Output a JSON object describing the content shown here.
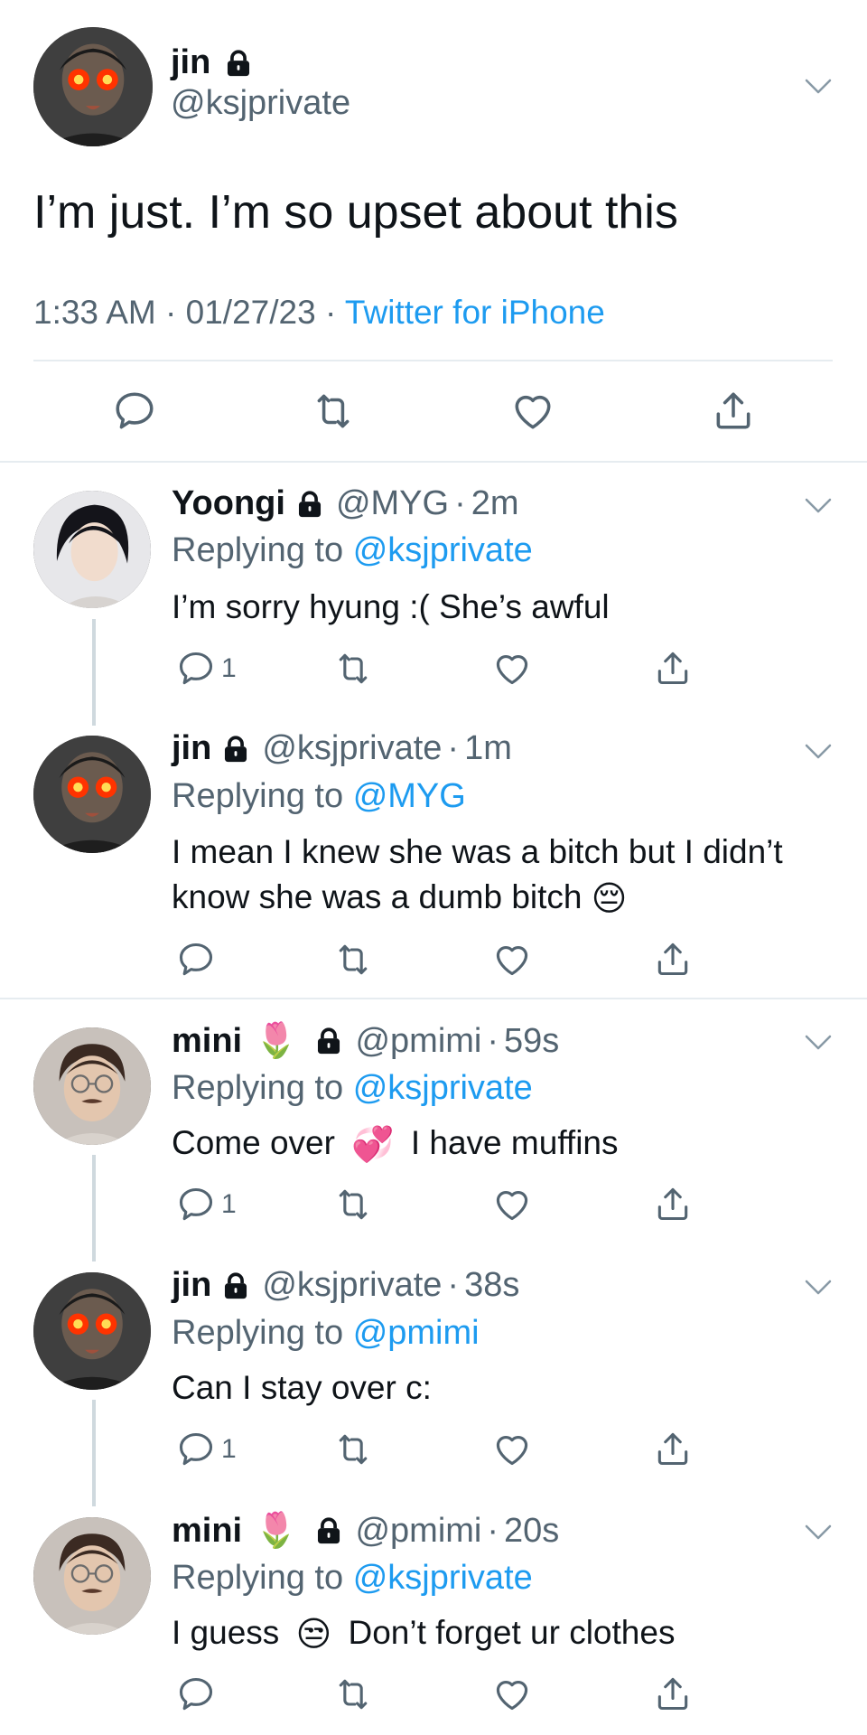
{
  "main_tweet": {
    "name": "jin",
    "handle": "@ksjprivate",
    "text": "I’m just. I’m so upset about this",
    "time": "1:33 AM",
    "date": "01/27/23",
    "source": "Twitter for iPhone",
    "sep": "·"
  },
  "replies": [
    {
      "name": "Yoongi",
      "handle": "@MYG",
      "time": "2m",
      "replying_label": "Replying to",
      "replying_to": "@ksjprivate",
      "text": "I’m sorry hyung :( She’s awful",
      "reply_count": "1"
    },
    {
      "name": "jin",
      "handle": "@ksjprivate",
      "time": "1m",
      "replying_label": "Replying to",
      "replying_to": "@MYG",
      "text_line1": "I mean I knew she was a bitch but I didn’t",
      "text_line2": "know she was a dumb bitch",
      "emoji": "😔"
    },
    {
      "name": "mini",
      "name_emoji": "🌷",
      "handle": "@pmimi",
      "time": "59s",
      "replying_label": "Replying to",
      "replying_to": "@ksjprivate",
      "text_a": "Come over",
      "emoji": "💞",
      "text_b": "I have muffins",
      "reply_count": "1"
    },
    {
      "name": "jin",
      "handle": "@ksjprivate",
      "time": "38s",
      "replying_label": "Replying to",
      "replying_to": "@pmimi",
      "text": "Can I stay over c:",
      "reply_count": "1"
    },
    {
      "name": "mini",
      "name_emoji": "🌷",
      "handle": "@pmimi",
      "time": "20s",
      "replying_label": "Replying to",
      "replying_to": "@ksjprivate",
      "text_a": "I guess",
      "emoji": "😒",
      "text_b": "Don’t forget ur clothes"
    }
  ],
  "colors": {
    "link": "#1d9bf0",
    "secondary": "#536471",
    "divider": "#e6ecf0",
    "thread": "#cfd9de"
  },
  "icons": [
    "lock-icon",
    "chevron-down-icon",
    "reply-icon",
    "retweet-icon",
    "like-icon",
    "share-icon"
  ]
}
